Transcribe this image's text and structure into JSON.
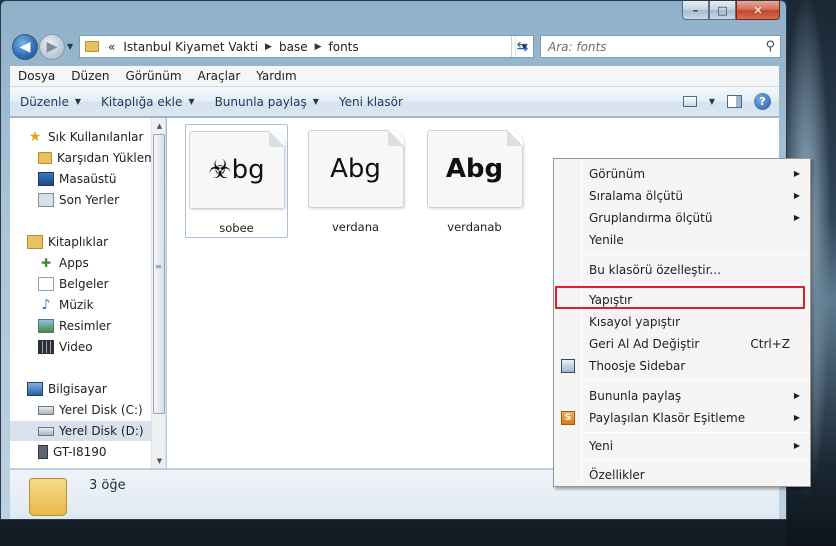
{
  "window": {
    "caption": {
      "minimize": "–",
      "maximize": "□",
      "close": "✕"
    }
  },
  "address": {
    "chevrons": "«",
    "segments": [
      "Istanbul Kiyamet Vakti",
      "base",
      "fonts"
    ]
  },
  "search": {
    "placeholder": "Ara: fonts"
  },
  "menubar": [
    "Dosya",
    "Düzen",
    "Görünüm",
    "Araçlar",
    "Yardım"
  ],
  "toolbar": {
    "organize": "Düzenle",
    "add_to_library": "Kitaplığa ekle",
    "share_with": "Bununla paylaş",
    "new_folder": "Yeni klasör"
  },
  "navpane": {
    "favorites": {
      "header": "Sık Kullanılanlar",
      "items": [
        "Karşıdan Yüklem",
        "Masaüstü",
        "Son Yerler"
      ]
    },
    "libraries": {
      "header": "Kitaplıklar",
      "items": [
        "Apps",
        "Belgeler",
        "Müzik",
        "Resimler",
        "Video"
      ]
    },
    "computer": {
      "header": "Bilgisayar",
      "items": [
        "Yerel Disk (C:)",
        "Yerel Disk (D:)",
        "GT-I8190"
      ]
    }
  },
  "files": [
    {
      "name": "sobee",
      "preview": "☣bg",
      "selected": true
    },
    {
      "name": "verdana",
      "preview": "Abg",
      "selected": false
    },
    {
      "name": "verdanab",
      "preview": "Abg",
      "selected": false
    }
  ],
  "status": {
    "count": "3 öğe"
  },
  "context_menu": [
    {
      "label": "Görünüm",
      "submenu": true
    },
    {
      "label": "Sıralama ölçütü",
      "submenu": true
    },
    {
      "label": "Gruplandırma ölçütü",
      "submenu": true
    },
    {
      "label": "Yenile"
    },
    {
      "label": "Bu klasörü özelleştir..."
    },
    {
      "label": "Yapıştır",
      "highlighted": true
    },
    {
      "label": "Kısayol yapıştır"
    },
    {
      "label": "Geri Al Ad Değiştir",
      "shortcut": "Ctrl+Z"
    },
    {
      "label": "Thoosje Sidebar",
      "icon": "sidebar-icon"
    },
    {
      "label": "Bununla paylaş",
      "submenu": true
    },
    {
      "label": "Paylaşılan Klasör Eşitleme",
      "submenu": true,
      "icon": "share-sync-icon"
    },
    {
      "label": "Yeni",
      "submenu": true
    },
    {
      "label": "Özellikler"
    }
  ],
  "colors": {
    "highlight_border": "#e0202d",
    "selection_border": "#a4c1de"
  }
}
